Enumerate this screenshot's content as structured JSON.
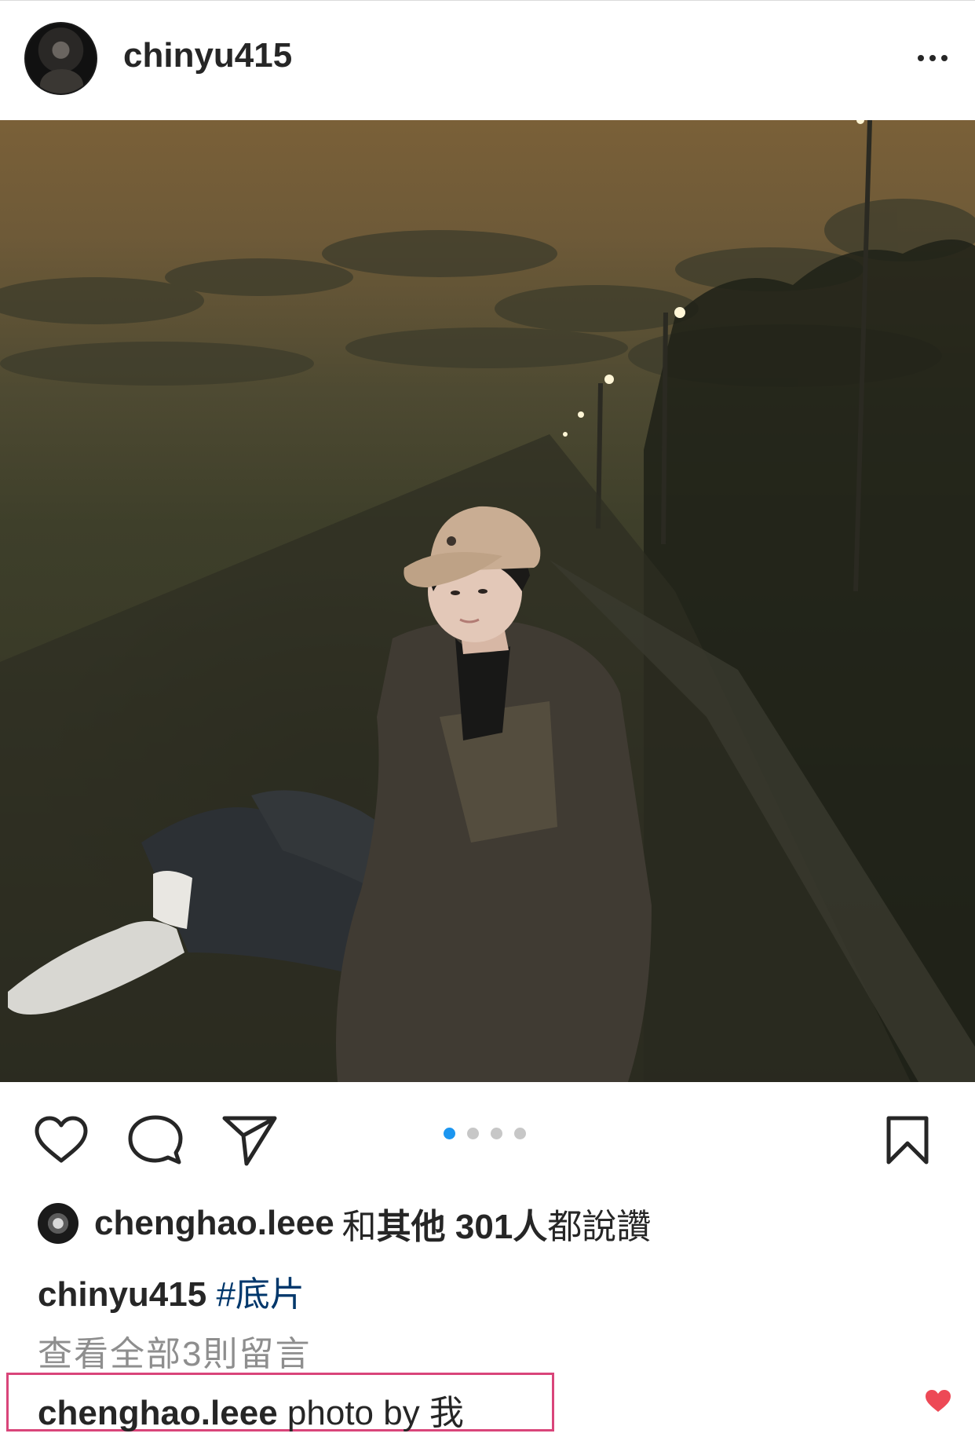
{
  "post": {
    "author": "chinyu415",
    "more_icon": "more-horizontal-icon"
  },
  "carousel": {
    "total": 4,
    "active_index": 0
  },
  "likes": {
    "liker": "chenghao.leee",
    "connector": "和",
    "others_text": "其他 301人",
    "suffix": "都說讚"
  },
  "caption": {
    "author": "chinyu415",
    "hashtag": "#底片"
  },
  "comments": {
    "view_all": "查看全部3則留言",
    "latest": {
      "author": "chenghao.leee",
      "text": "photo by 我"
    }
  },
  "colors": {
    "accent_blue": "#1c96f0",
    "hashtag": "#00376b",
    "highlight_box": "#d9457a",
    "like_red": "#ed4956"
  }
}
